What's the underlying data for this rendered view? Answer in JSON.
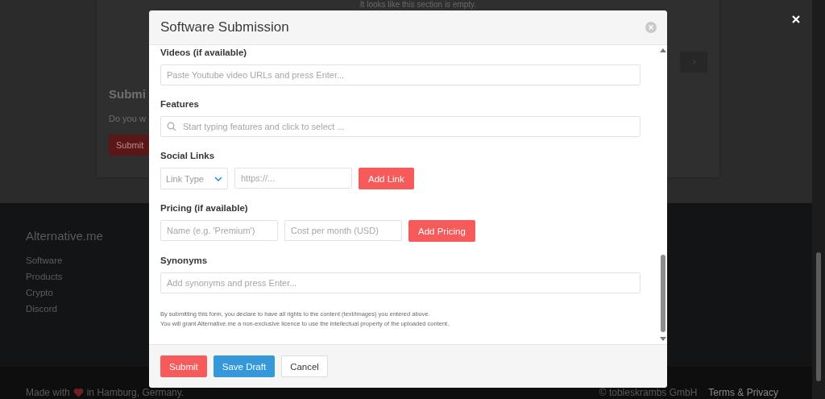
{
  "background_page": {
    "empty_note": "It looks like this section is empty.",
    "submit_heading": "Submi",
    "submit_text": "Do you w",
    "submit_button": "Submit",
    "footer": {
      "brand": "Alternative.me",
      "links": [
        "Software",
        "Products",
        "Crypto",
        "Discord"
      ],
      "made_with_before": "Made with",
      "made_with_after": "in Hamburg, Germany.",
      "copyright": "© tobleskrambs GmbH",
      "legal": "Terms & Privacy"
    }
  },
  "modal": {
    "title": "Software Submission",
    "sections": [
      {
        "kind": "text",
        "label": "Videos (if available)",
        "placeholder": "Paste Youtube video URLs and press Enter..."
      },
      {
        "kind": "search",
        "label": "Features",
        "placeholder": "Start typing features and click to select ..."
      },
      {
        "kind": "links",
        "label": "Social Links",
        "select": "Link Type",
        "placeholder": "https://...",
        "button": "Add Link"
      },
      {
        "kind": "pricing",
        "label": "Pricing (if available)",
        "name_placeholder": "Name (e.g. 'Premium')",
        "cost_placeholder": "Cost per month (USD)",
        "button": "Add Pricing"
      },
      {
        "kind": "text",
        "label": "Synonyms",
        "placeholder": "Add synonyms and press Enter..."
      }
    ],
    "disclaimer": [
      "By submitting this form, you declare to have all rights to the content (text/images) you entered above.",
      "You will grant Alternative.me a non-exclusive licence to use the intellectual property of the uploaded content."
    ],
    "buttons": [
      {
        "kind": "primary",
        "label": "Submit"
      },
      {
        "kind": "info",
        "label": "Save Draft"
      },
      {
        "kind": "plain",
        "label": "Cancel"
      }
    ]
  }
}
